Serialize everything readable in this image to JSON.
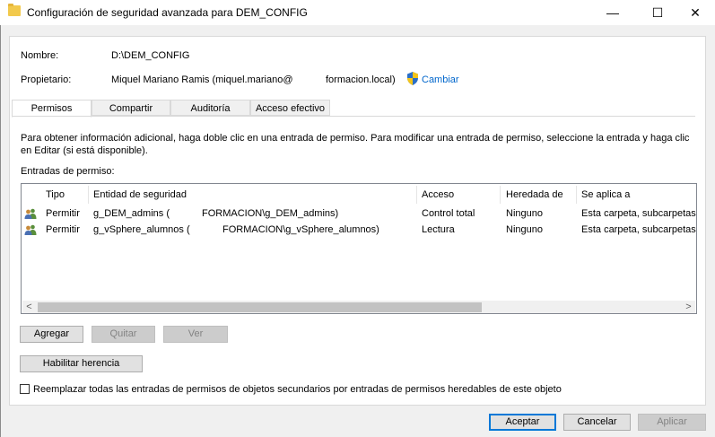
{
  "window": {
    "title": "Configuración de seguridad avanzada para DEM_CONFIG",
    "minimize_glyph": "—",
    "maximize_glyph": "☐",
    "close_glyph": "✕"
  },
  "info": {
    "name_label": "Nombre:",
    "name_value": "D:\\DEM_CONFIG",
    "owner_label": "Propietario:",
    "owner_value_1": "Miquel Mariano Ramis (miquel.mariano@",
    "owner_value_2": "formacion.local)",
    "change_link": "Cambiar"
  },
  "tabs": [
    {
      "label": "Permisos",
      "active": true
    },
    {
      "label": "Compartir",
      "active": false
    },
    {
      "label": "Auditoría",
      "active": false
    },
    {
      "label": "Acceso efectivo",
      "active": false
    }
  ],
  "description": "Para obtener información adicional, haga doble clic en una entrada de permiso. Para modificar una entrada de permiso, seleccione la entrada y haga clic en Editar (si está disponible).",
  "entries_label": "Entradas de permiso:",
  "columns": [
    "Tipo",
    "Entidad de seguridad",
    "Acceso",
    "Heredada de",
    "Se aplica a"
  ],
  "rows": [
    {
      "type": "Permitir",
      "principal_a": "g_DEM_admins (",
      "principal_b": "FORMACION\\g_DEM_admins)",
      "access": "Control total",
      "inherited": "Ninguno",
      "applies": "Esta carpeta, subcarpetas y"
    },
    {
      "type": "Permitir",
      "principal_a": "g_vSphere_alumnos (",
      "principal_b": "FORMACION\\g_vSphere_alumnos)",
      "access": "Lectura",
      "inherited": "Ninguno",
      "applies": "Esta carpeta, subcarpetas y"
    }
  ],
  "scroll": {
    "left": "<",
    "right": ">"
  },
  "buttons": {
    "add": "Agregar",
    "remove": "Quitar",
    "view": "Ver",
    "enable_inheritance": "Habilitar herencia",
    "ok": "Aceptar",
    "cancel": "Cancelar",
    "apply": "Aplicar"
  },
  "replace_checkbox": {
    "label": "Reemplazar todas las entradas de permisos de objetos secundarios por entradas de permisos heredables de este objeto",
    "checked": false
  },
  "colors": {
    "accent": "#0078d7",
    "link": "#0066cc"
  }
}
